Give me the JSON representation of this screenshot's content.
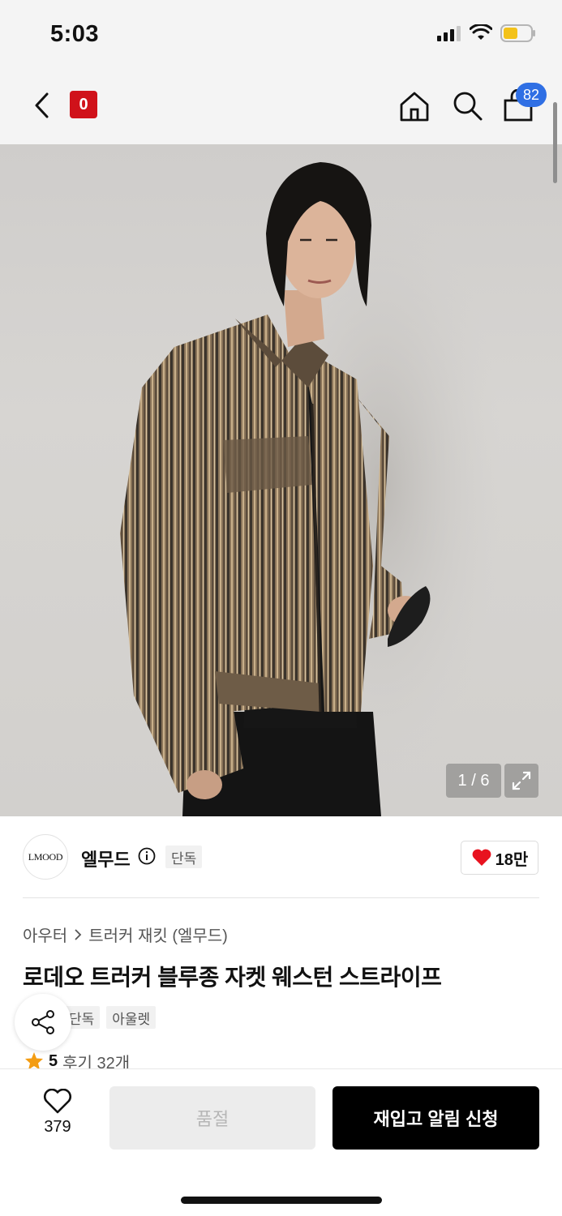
{
  "status_bar": {
    "time": "5:03"
  },
  "header": {
    "brand_logo_text": "0",
    "cart_count": "82",
    "icons": [
      "back-arrow-icon",
      "home-icon",
      "search-icon",
      "shopping-bag-icon"
    ]
  },
  "product_image": {
    "counter": "1 / 6",
    "description_icon": "expand-icon"
  },
  "brand": {
    "logo_text": "LMOOD",
    "name": "엘무드",
    "exclusive_tag": "단독",
    "likes": "18만"
  },
  "product": {
    "breadcrumb": [
      "아우터",
      "트러커 재킷 (엘무드)"
    ],
    "title": "로데오 트러커 블루종 자켓 웨스턴 스트라이프",
    "tags": [
      "단독",
      "아울렛"
    ],
    "rating": "5",
    "review_label": "후기 32개"
  },
  "bottom_bar": {
    "wish_count": "379",
    "soldout_label": "품절",
    "restock_label": "재입고 알림 신청"
  },
  "colors": {
    "brand_red": "#d0121a",
    "badge_blue": "#2f6fe4",
    "heart_red": "#e8121f",
    "star_orange": "#f39c12",
    "button_black": "#000000",
    "disabled_gray": "#ececec"
  }
}
